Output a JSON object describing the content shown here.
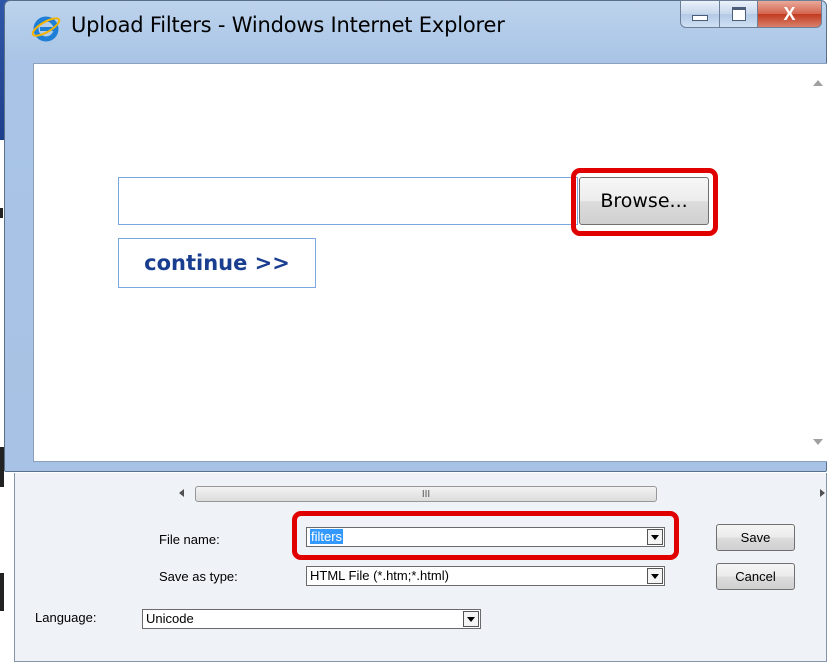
{
  "window": {
    "title": "Upload Filters - Windows Internet Explorer",
    "close_glyph": "X"
  },
  "page": {
    "file_input_value": "",
    "browse_label": "Browse...",
    "continue_label": "continue >>"
  },
  "save_dialog": {
    "scroll_thumb_grip": "III",
    "file_name_label": "File name:",
    "file_name_value": "filters",
    "save_as_type_label": "Save as type:",
    "save_as_type_value": "HTML File (*.htm;*.html)",
    "language_label": "Language:",
    "language_value": "Unicode",
    "save_label": "Save",
    "cancel_label": "Cancel"
  },
  "colors": {
    "highlight": "#e00000",
    "link_blue": "#1a3e8f",
    "selection": "#3399ff"
  },
  "icons": [
    "ie-logo-icon",
    "minimize-icon",
    "maximize-icon",
    "close-icon",
    "scroll-up-icon",
    "scroll-down-icon",
    "scroll-left-icon",
    "scroll-right-icon",
    "dropdown-arrow-icon"
  ]
}
